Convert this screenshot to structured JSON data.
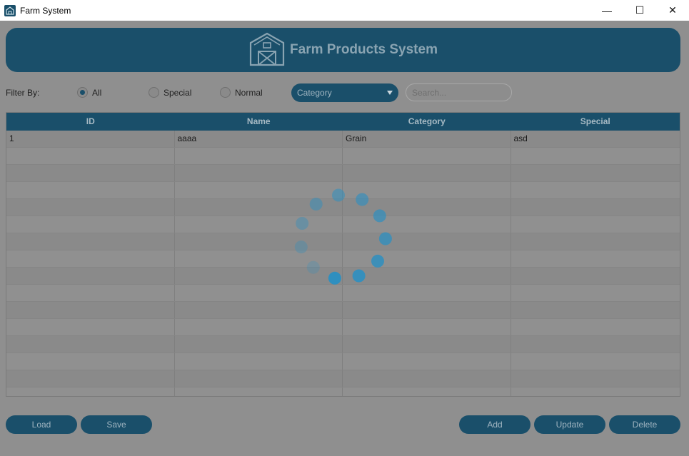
{
  "window": {
    "title": "Farm System",
    "minimize_glyph": "—",
    "maximize_glyph": "☐",
    "close_glyph": "✕"
  },
  "header": {
    "title": "Farm Products System",
    "icon": "barn-icon"
  },
  "filter": {
    "label": "Filter By:",
    "options": [
      {
        "label": "All",
        "checked": true
      },
      {
        "label": "Special",
        "checked": false
      },
      {
        "label": "Normal",
        "checked": false
      }
    ],
    "category_select": {
      "value": "Category"
    },
    "search": {
      "placeholder": "Search..."
    }
  },
  "table": {
    "columns": [
      "ID",
      "Name",
      "Category",
      "Special"
    ],
    "rows": [
      [
        "1",
        "aaaa",
        "Grain",
        "asd"
      ]
    ]
  },
  "buttons": {
    "load": "Load",
    "save": "Save",
    "add": "Add",
    "update": "Update",
    "delete": "Delete"
  },
  "colors": {
    "accent": "#1a4f6a",
    "overlay": "#8f8f8f",
    "spinner": "#2f8fbf"
  },
  "spinner": {
    "state": "loading"
  }
}
